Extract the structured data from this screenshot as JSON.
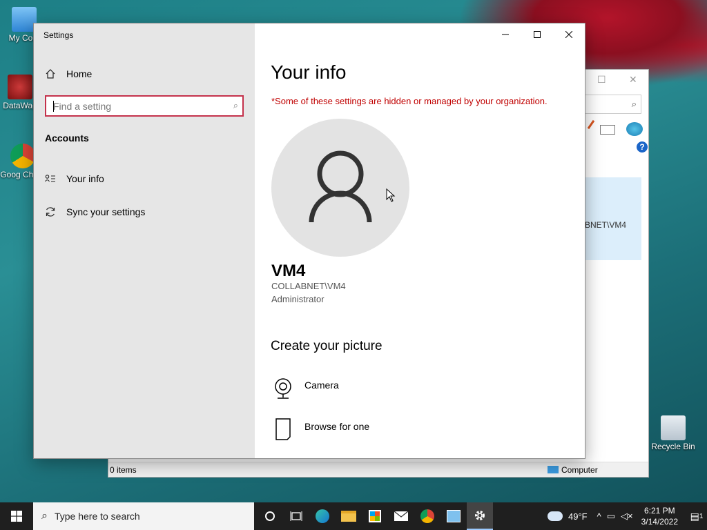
{
  "desktop": {
    "icons": [
      {
        "label": "My Com"
      },
      {
        "label": "DataWag"
      },
      {
        "label": "Goog Chron"
      },
      {
        "label": "Recycle Bin"
      }
    ]
  },
  "explorer": {
    "selected_text": "BNET\\VM4",
    "status_items": "0 items",
    "status_location": "Computer",
    "help_glyph": "?"
  },
  "settings": {
    "window_title": "Settings",
    "sidebar": {
      "home_label": "Home",
      "search_placeholder": "Find a setting",
      "section_heading": "Accounts",
      "items": [
        {
          "label": "Your info",
          "icon": "person-list-icon"
        },
        {
          "label": "Sync your settings",
          "icon": "sync-icon"
        }
      ]
    },
    "content": {
      "page_title": "Your info",
      "org_notice": "*Some of these settings are hidden or managed by your organization.",
      "username": "VM4",
      "account": "COLLABNET\\VM4",
      "role": "Administrator",
      "create_picture_heading": "Create your picture",
      "options": [
        {
          "label": "Camera",
          "icon": "camera-icon"
        },
        {
          "label": "Browse for one",
          "icon": "file-icon"
        }
      ]
    },
    "accent_color": "#c4314b",
    "notice_color": "#c00000"
  },
  "taskbar": {
    "search_placeholder": "Type here to search",
    "weather": "49°F",
    "time": "6:21 PM",
    "date": "3/14/2022",
    "notification_count": "1"
  }
}
